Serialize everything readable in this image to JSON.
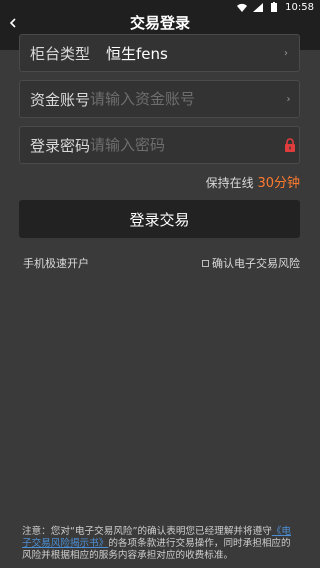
{
  "status": {
    "time": "10:58",
    "icons": [
      "wifi-icon",
      "signal-icon",
      "battery-icon"
    ]
  },
  "header": {
    "back_icon": "back-arrow-icon",
    "title": "交易登录"
  },
  "form": {
    "counter_type": {
      "label": "柜台类型",
      "value": "恒生fens"
    },
    "account": {
      "label": "资金账号",
      "placeholder": "请输入资金账号"
    },
    "password": {
      "label": "登录密码",
      "placeholder": "请输入密码",
      "icon": "lock-icon"
    }
  },
  "online": {
    "label": "保持在线",
    "duration": "30分钟"
  },
  "login_button": "登录交易",
  "open_account_link": "手机极速开户",
  "confirm_risk_label": "确认电子交易风险",
  "notice": {
    "prefix": "注意：您对“电子交易风险”的确认表明您已经理解并将遵守",
    "link": "《电子交易风险揭示书》",
    "suffix": "的各项条款进行交易操作，同时承担相应的风险并根据相应的服务内容承担对应的收费标准。"
  },
  "colors": {
    "accent": "#ff7a2f",
    "lock": "#e23b3b",
    "link": "#4b8fd6",
    "background": "#3a3a3a"
  }
}
